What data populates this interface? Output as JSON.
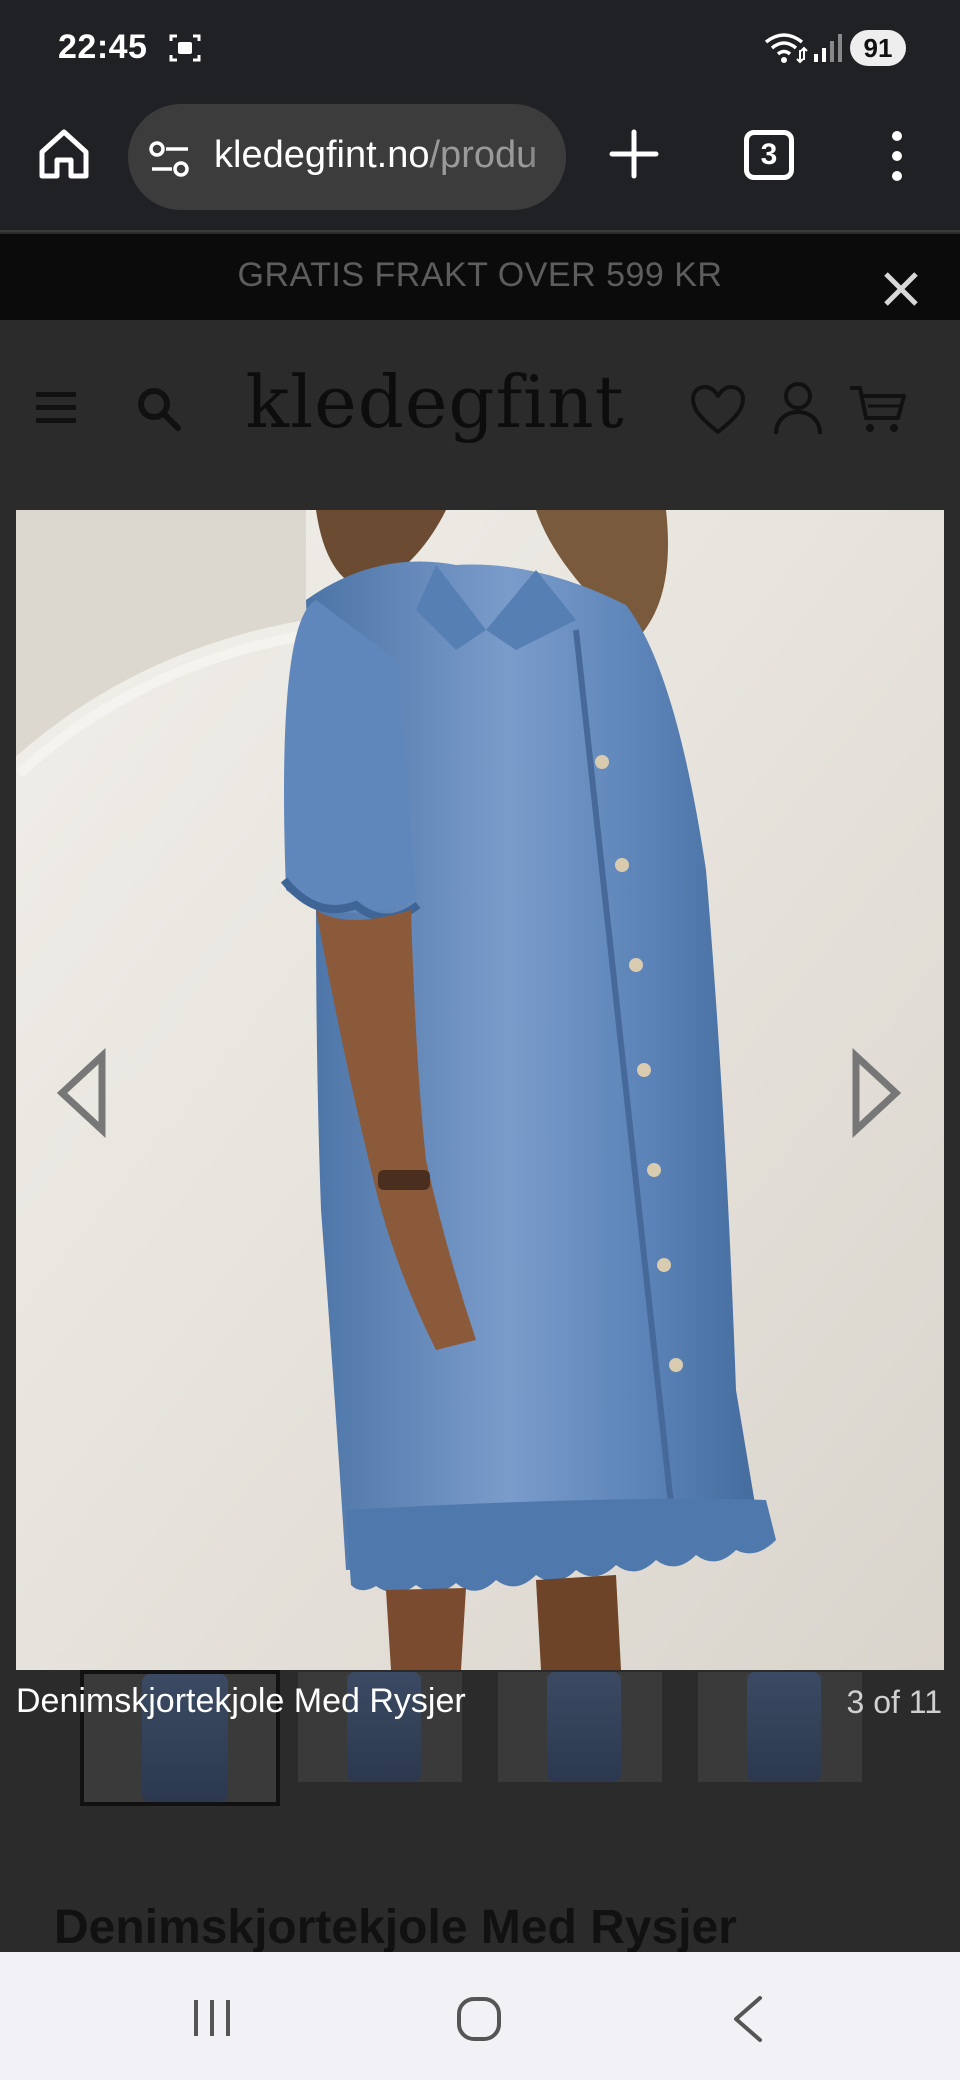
{
  "status_bar": {
    "time": "22:45",
    "battery": "91",
    "icons": [
      "screenshot-icon",
      "wifi-icon",
      "signal-icon"
    ]
  },
  "browser": {
    "url_domain": "kledegfint.no",
    "url_path": "/produ",
    "tab_count": "3",
    "icons": [
      "home-icon",
      "site-settings-icon",
      "plus-icon",
      "more-vert-icon"
    ]
  },
  "promo": {
    "text": "GRATIS FRAKT OVER 599 KR",
    "icon": "close-icon"
  },
  "site_header": {
    "logo": "kledegfint",
    "icons": [
      "menu-icon",
      "search-icon",
      "heart-icon",
      "user-icon",
      "cart-icon"
    ]
  },
  "gallery": {
    "caption": "Denimskjortekjole Med Rysjer",
    "counter": "3 of 11",
    "icons": [
      "chevron-left-icon",
      "chevron-right-icon"
    ]
  },
  "product": {
    "title": "Denimskjortekjole Med Rysjer"
  },
  "nav_bar": {
    "icons": [
      "recents-icon",
      "home-circle-icon",
      "back-icon"
    ]
  },
  "colors": {
    "background": "#2b2b2b",
    "browser_bar": "#202124",
    "promo_bg": "#0b0b0b",
    "denim": "#5b84b8"
  }
}
